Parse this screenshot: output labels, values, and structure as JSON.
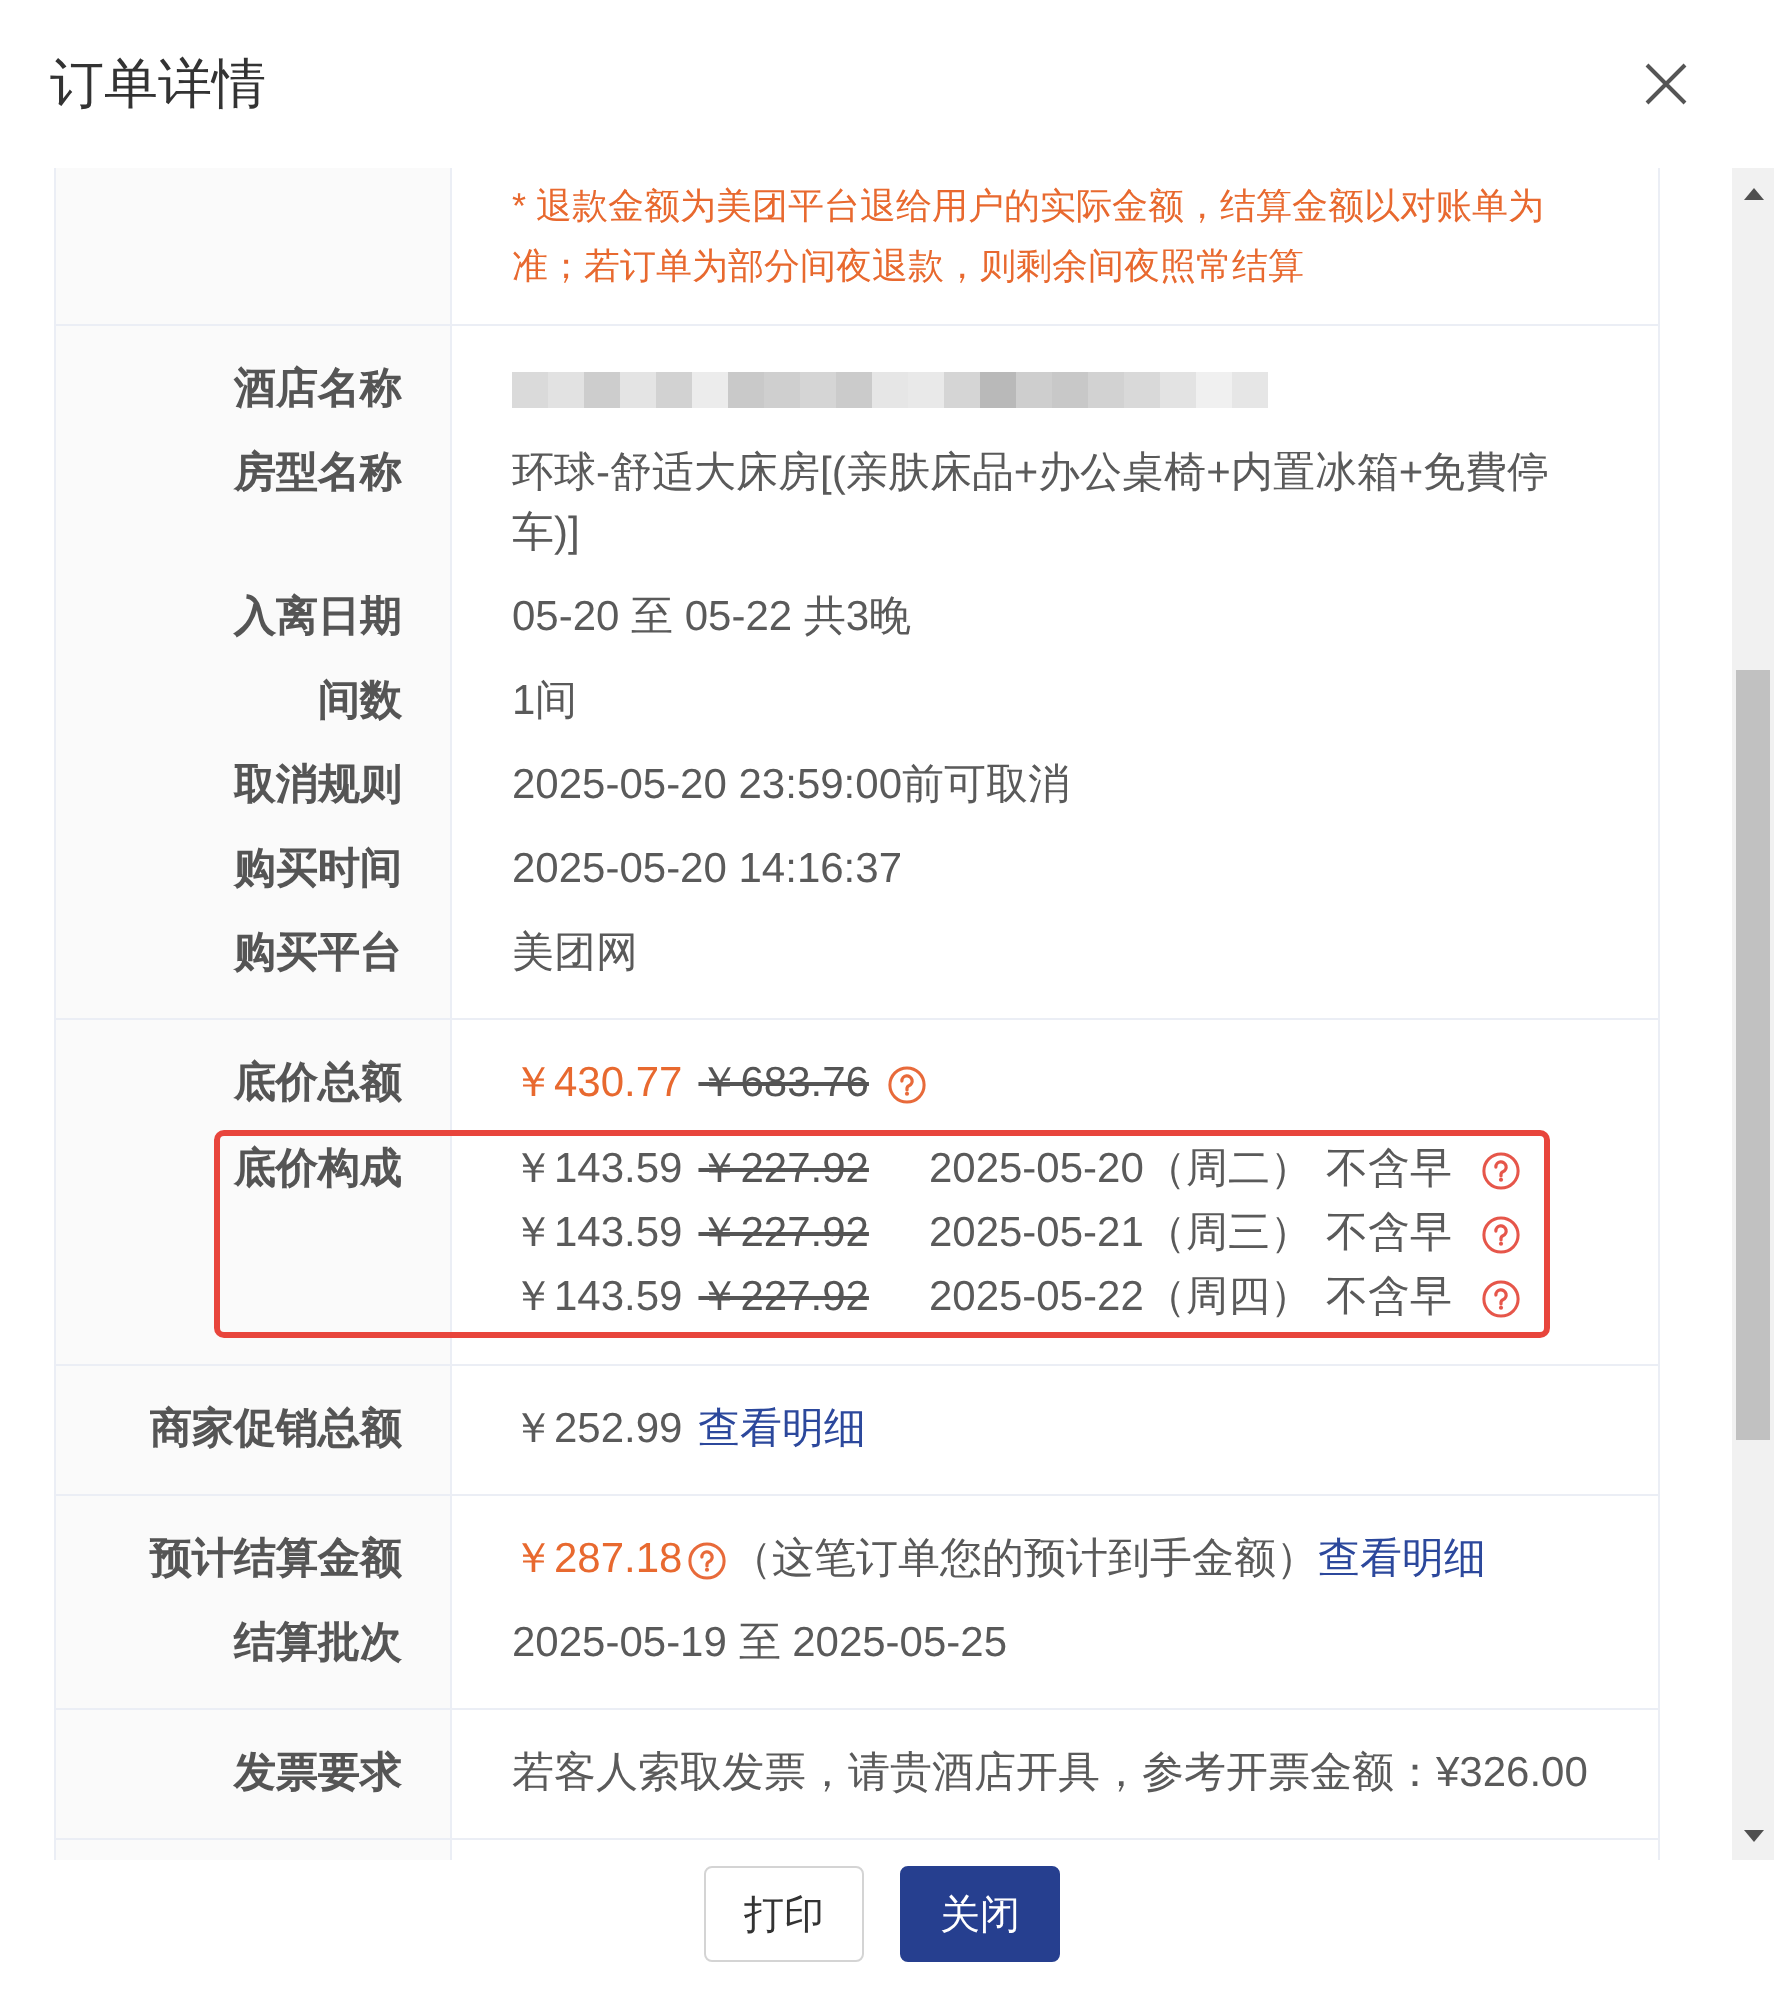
{
  "dialog": {
    "title": "订单详情"
  },
  "sections": [
    {
      "items": [
        {
          "kind": "note",
          "value": "* 退款金额为美团平台退给用户的实际金额，结算金额以对账单为准；若订单为部分间夜退款，则剩余间夜照常结算"
        }
      ]
    },
    {
      "items": [
        {
          "kind": "redacted",
          "label": "酒店名称"
        },
        {
          "kind": "text",
          "label": "房型名称",
          "value": "环球-舒适大床房[(亲肤床品+办公桌椅+内置冰箱+免費停车)]"
        },
        {
          "kind": "text",
          "label": "入离日期",
          "value": "05-20 至 05-22 共3晚"
        },
        {
          "kind": "text",
          "label": "间数",
          "value": "1间"
        },
        {
          "kind": "text",
          "label": "取消规则",
          "value": "2025-05-20 23:59:00前可取消"
        },
        {
          "kind": "text",
          "label": "购买时间",
          "value": "2025-05-20 14:16:37"
        },
        {
          "kind": "text",
          "label": "购买平台",
          "value": "美团网"
        }
      ]
    },
    {
      "items": [
        {
          "kind": "price",
          "label": "底价总额",
          "price": "￥430.77",
          "original_price": "￥683.76"
        },
        {
          "kind": "breakdown",
          "label": "底价构成",
          "highlighted": true,
          "lines": [
            {
              "price": "￥143.59",
              "original_price": "￥227.92",
              "date": "2025-05-20（周二）",
              "meal": "不含早"
            },
            {
              "price": "￥143.59",
              "original_price": "￥227.92",
              "date": "2025-05-21（周三）",
              "meal": "不含早"
            },
            {
              "price": "￥143.59",
              "original_price": "￥227.92",
              "date": "2025-05-22（周四）",
              "meal": "不含早"
            }
          ]
        }
      ]
    },
    {
      "items": [
        {
          "kind": "amount_link",
          "label": "商家促销总额",
          "amount": "￥252.99",
          "link": "查看明细"
        }
      ]
    },
    {
      "items": [
        {
          "kind": "settlement",
          "label": "预计结算金额",
          "amount": "￥287.18",
          "note": "（这笔订单您的预计到手金额）",
          "link": "查看明细"
        },
        {
          "kind": "text",
          "label": "结算批次",
          "value": "2025-05-19 至 2025-05-25"
        }
      ]
    },
    {
      "items": [
        {
          "kind": "text",
          "label": "发票要求",
          "value": "若客人索取发票，请贵酒店开具，参考开票金额：¥326.00"
        }
      ]
    }
  ],
  "footer": {
    "buttons": [
      {
        "label": "打印",
        "kind": "default"
      },
      {
        "label": "关闭",
        "kind": "primary"
      }
    ]
  }
}
